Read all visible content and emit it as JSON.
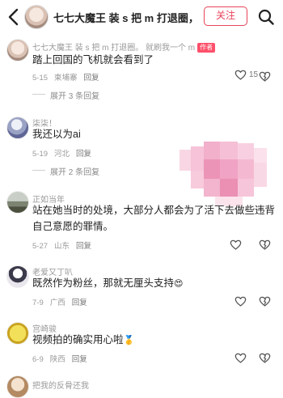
{
  "header": {
    "title": "七七大魔王 装 s 把 m 打退圈，就…",
    "follow_label": "关注"
  },
  "comments": [
    {
      "username": "七七大魔王 装 s 把 m 打退圈。  就刷我一个 m",
      "author_tag": "作者",
      "text": "踏上回国的飞机就会看到了",
      "date": "5-15",
      "location": "柬埔寨",
      "reply_label": "回复",
      "likes": "15",
      "expand": "展开 3 条回复"
    },
    {
      "username": "柒柒！",
      "text": "我还以为ai",
      "date": "5-19",
      "location": "河北",
      "reply_label": "回复",
      "expand": "展开 2 条回复"
    },
    {
      "username": "正如当年",
      "text": "站在她当时的处境，大部分人都会为了活下去做些违背自己意愿的罪情。",
      "date": "5-27",
      "location": "山东",
      "reply_label": "回复"
    },
    {
      "username": "老爱又丁叭",
      "text": "既然作为粉丝，那就无厘头支持",
      "date": "7-9",
      "location": "广西",
      "reply_label": "回复"
    },
    {
      "username": "宫崎骏",
      "text": "视频拍的确实用心啦",
      "date": "6-9",
      "location": "陕西",
      "reply_label": "回复"
    },
    {
      "username": "把我的反骨还我"
    }
  ],
  "colors": {
    "accent": "#e8445a",
    "mosaic": "#f0a3c4"
  }
}
